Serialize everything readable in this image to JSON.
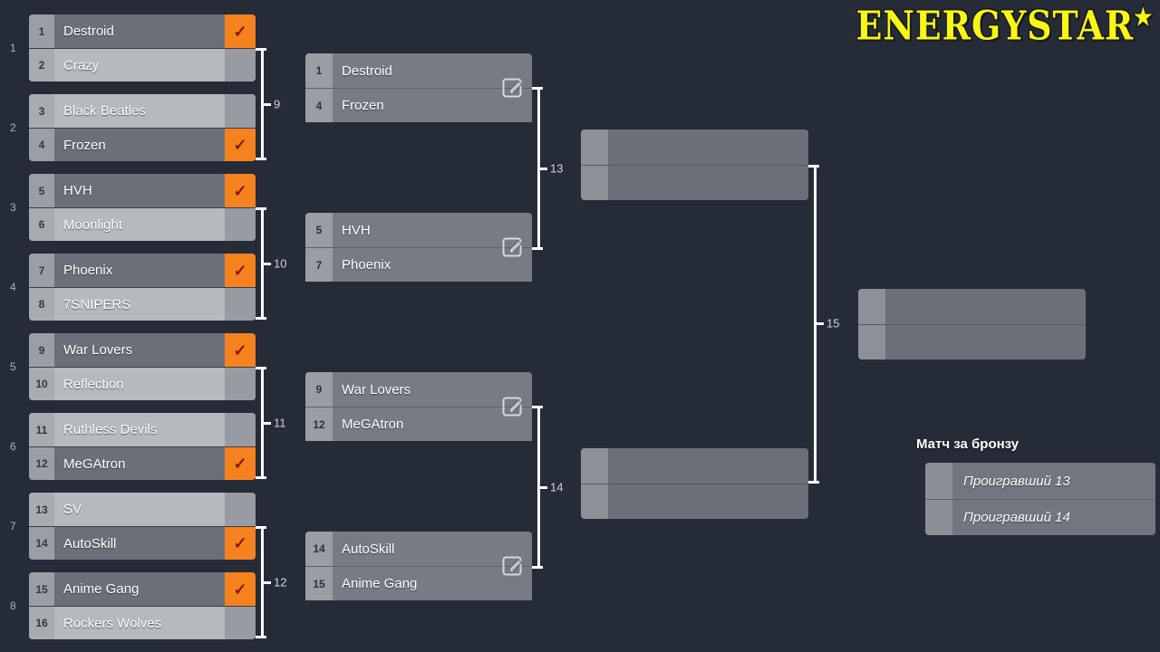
{
  "app": {
    "logo_text": "ENERGYSTAR",
    "logo_star": "★",
    "logo_color": "#f7f716",
    "background_color": "#262b38",
    "accent_color": "#f5821f"
  },
  "bracket": {
    "round1": {
      "match_labels": [
        "1",
        "2",
        "3",
        "4",
        "5",
        "6",
        "7",
        "8"
      ],
      "matches": [
        {
          "label": "1",
          "teams": [
            {
              "seed": "1",
              "name": "Destroid",
              "winner": true
            },
            {
              "seed": "2",
              "name": "Crazy",
              "winner": false
            }
          ]
        },
        {
          "label": "2",
          "teams": [
            {
              "seed": "3",
              "name": "Black Beatles",
              "winner": false
            },
            {
              "seed": "4",
              "name": "Frozen",
              "winner": true
            }
          ]
        },
        {
          "label": "3",
          "teams": [
            {
              "seed": "5",
              "name": "HVH",
              "winner": true
            },
            {
              "seed": "6",
              "name": "Moonlight",
              "winner": false
            }
          ]
        },
        {
          "label": "4",
          "teams": [
            {
              "seed": "7",
              "name": "Phoenix",
              "winner": true
            },
            {
              "seed": "8",
              "name": "7SNIPERS",
              "winner": false
            }
          ]
        },
        {
          "label": "5",
          "teams": [
            {
              "seed": "9",
              "name": "War Lovers",
              "winner": true
            },
            {
              "seed": "10",
              "name": "Reflection",
              "winner": false
            }
          ]
        },
        {
          "label": "6",
          "teams": [
            {
              "seed": "11",
              "name": "Ruthless Devils",
              "winner": false
            },
            {
              "seed": "12",
              "name": "MeGAtron",
              "winner": true
            }
          ]
        },
        {
          "label": "7",
          "teams": [
            {
              "seed": "13",
              "name": "SV",
              "winner": false
            },
            {
              "seed": "14",
              "name": "AutoSkill",
              "winner": true
            }
          ]
        },
        {
          "label": "8",
          "teams": [
            {
              "seed": "15",
              "name": "Anime Gang",
              "winner": true
            },
            {
              "seed": "16",
              "name": "Rockers Wolves",
              "winner": false
            }
          ]
        }
      ]
    },
    "round2": {
      "matches": [
        {
          "label": "9",
          "edit_icon": "edit-pencil-icon",
          "teams": [
            {
              "seed": "1",
              "name": "Destroid"
            },
            {
              "seed": "4",
              "name": "Frozen"
            }
          ]
        },
        {
          "label": "10",
          "edit_icon": "edit-pencil-icon",
          "teams": [
            {
              "seed": "5",
              "name": "HVH"
            },
            {
              "seed": "7",
              "name": "Phoenix"
            }
          ]
        },
        {
          "label": "11",
          "edit_icon": "edit-pencil-icon",
          "teams": [
            {
              "seed": "9",
              "name": "War Lovers"
            },
            {
              "seed": "12",
              "name": "MeGAtron"
            }
          ]
        },
        {
          "label": "12",
          "edit_icon": "edit-pencil-icon",
          "teams": [
            {
              "seed": "14",
              "name": "AutoSkill"
            },
            {
              "seed": "15",
              "name": "Anime Gang"
            }
          ]
        }
      ]
    },
    "round3": {
      "matches": [
        {
          "label": "13",
          "teams": [
            {
              "seed": "",
              "name": ""
            },
            {
              "seed": "",
              "name": ""
            }
          ]
        },
        {
          "label": "14",
          "teams": [
            {
              "seed": "",
              "name": ""
            },
            {
              "seed": "",
              "name": ""
            }
          ]
        }
      ]
    },
    "round4": {
      "matches": [
        {
          "label": "15",
          "teams": [
            {
              "seed": "",
              "name": ""
            },
            {
              "seed": "",
              "name": ""
            }
          ]
        }
      ]
    }
  },
  "bronze": {
    "title": "Матч за бронзу",
    "teams": [
      {
        "seed": "",
        "name": "Проигравший 13"
      },
      {
        "seed": "",
        "name": "Проигравший 14"
      }
    ]
  },
  "icons": {
    "check": "✓"
  }
}
